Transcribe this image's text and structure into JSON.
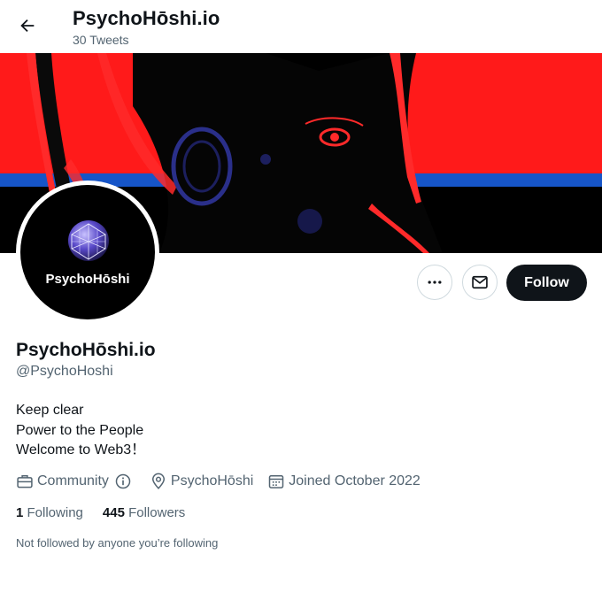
{
  "header": {
    "title": "PsychoHōshi.io",
    "tweet_count": "30 Tweets"
  },
  "avatar": {
    "label": "PsychoHōshi"
  },
  "actions": {
    "follow_label": "Follow"
  },
  "profile": {
    "name": "PsychoHōshi.io",
    "handle": "@PsychoHoshi",
    "bio": [
      "Keep clear",
      "Power to the People",
      "Welcome to Web3！"
    ],
    "category": "Community",
    "location": "PsychoHōshi",
    "joined": "Joined October 2022",
    "following_count": "1",
    "following_label": "Following",
    "followers_count": "445",
    "followers_label": "Followers",
    "not_followed_text": "Not followed by anyone you’re following"
  },
  "icons": {
    "back": "arrow-left-icon",
    "more": "more-horizontal-icon",
    "message": "envelope-icon",
    "category": "briefcase-icon",
    "info": "info-circle-icon",
    "location": "location-pin-icon",
    "joined": "calendar-icon"
  },
  "colors": {
    "banner_red": "#ff1a1a",
    "banner_blue": "#1655c8",
    "follow_button": "#0f1419",
    "secondary_text": "#536471"
  }
}
